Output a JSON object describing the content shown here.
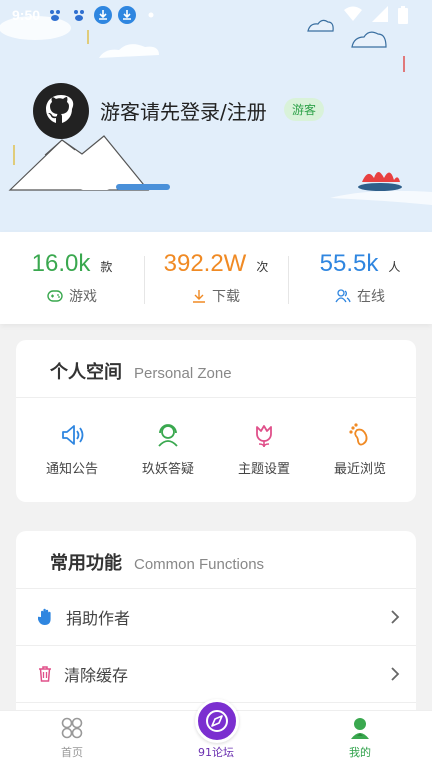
{
  "status": {
    "time": "9:50"
  },
  "profile": {
    "login_text": "游客请先登录/注册",
    "badge": "游客"
  },
  "stats": [
    {
      "value": "16.0k",
      "unit": "款",
      "label": "游戏",
      "color": "#3aa84f",
      "icon": "gamepad-icon"
    },
    {
      "value": "392.2W",
      "unit": "次",
      "label": "下载",
      "color": "#f08a24",
      "icon": "download-icon"
    },
    {
      "value": "55.5k",
      "unit": "人",
      "label": "在线",
      "color": "#2f86e0",
      "icon": "users-icon"
    }
  ],
  "personal_zone": {
    "title_cn": "个人空间",
    "title_en": "Personal Zone",
    "items": [
      {
        "label": "通知公告",
        "icon": "megaphone-icon",
        "color": "#2f86e0"
      },
      {
        "label": "玖妖答疑",
        "icon": "support-icon",
        "color": "#3aa84f"
      },
      {
        "label": "主题设置",
        "icon": "tulip-icon",
        "color": "#e0508a"
      },
      {
        "label": "最近浏览",
        "icon": "footprint-icon",
        "color": "#f08a24"
      }
    ]
  },
  "common_functions": {
    "title_cn": "常用功能",
    "title_en": "Common Functions",
    "items": [
      {
        "label": "捐助作者",
        "icon": "hand-icon",
        "color": "#2f86e0"
      },
      {
        "label": "清除缓存",
        "icon": "trash-icon",
        "color": "#e0508a"
      }
    ]
  },
  "nav": {
    "home": "首页",
    "forum": "91论坛",
    "mine": "我的"
  }
}
